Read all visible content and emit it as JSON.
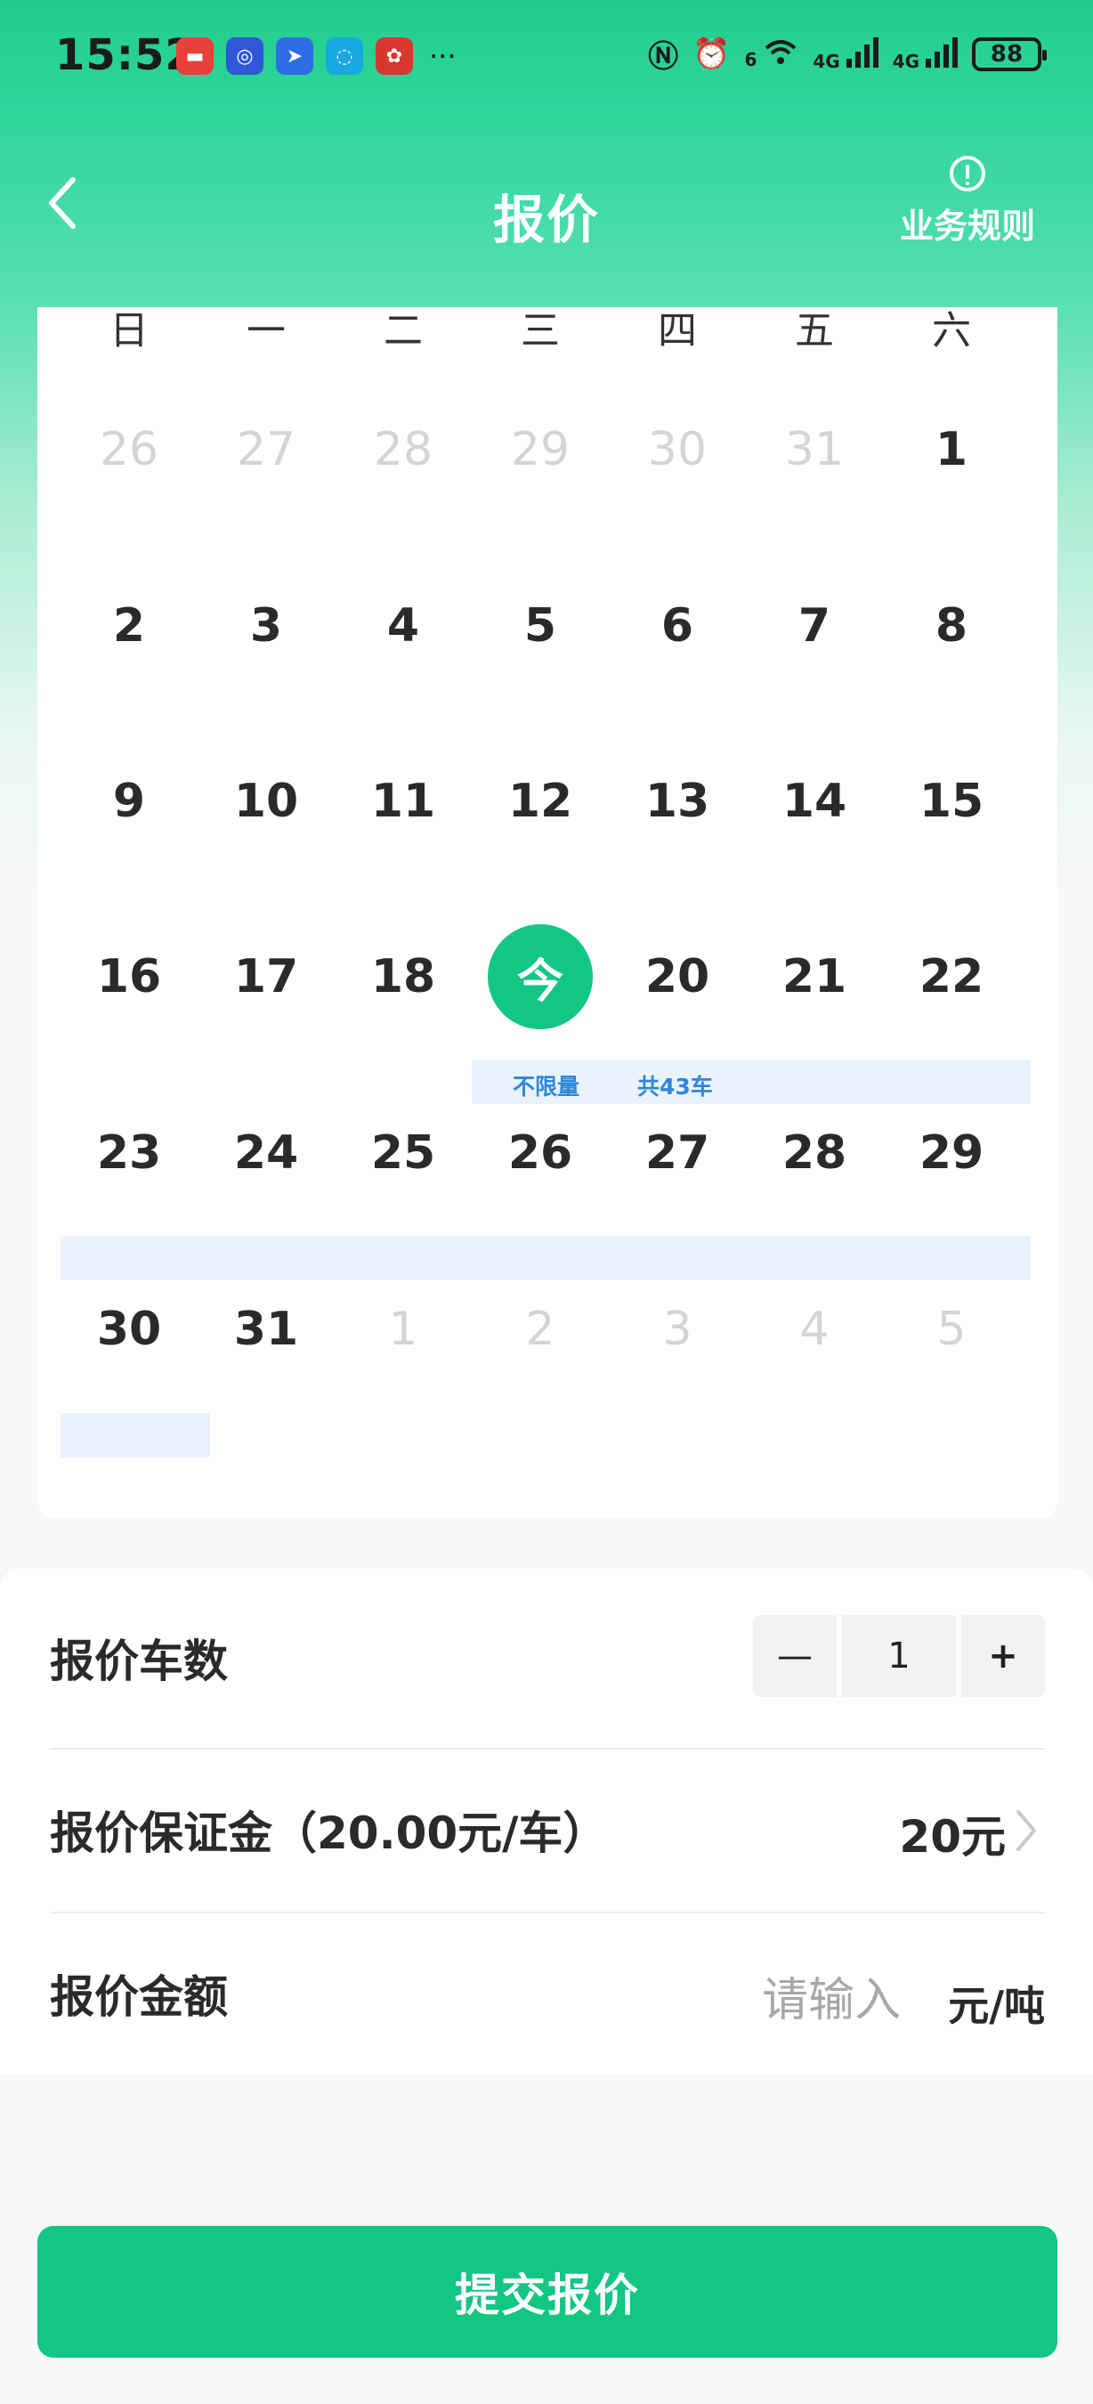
{
  "status_bar": {
    "time": "15:52",
    "app_icons": [
      {
        "name": "huawei-icon",
        "color": "#e8403a"
      },
      {
        "name": "ring-app-icon",
        "color": "#2f57d8"
      },
      {
        "name": "dingtalk-icon",
        "color": "#2d6ee6"
      },
      {
        "name": "chat-app-icon",
        "color": "#1ba8e0"
      },
      {
        "name": "flower-app-icon",
        "color": "#d8362f"
      }
    ],
    "network_1": "6",
    "network_2": "4G",
    "network_3": "4G",
    "battery": "88"
  },
  "header": {
    "title": "报价",
    "rules_label": "业务规则"
  },
  "calendar": {
    "weekdays": [
      "日",
      "一",
      "二",
      "三",
      "四",
      "五",
      "六"
    ],
    "rows": [
      [
        {
          "d": "26",
          "m": true
        },
        {
          "d": "27",
          "m": true
        },
        {
          "d": "28",
          "m": true
        },
        {
          "d": "29",
          "m": true
        },
        {
          "d": "30",
          "m": true
        },
        {
          "d": "31",
          "m": true
        },
        {
          "d": "1",
          "m": false
        }
      ],
      [
        {
          "d": "2",
          "m": false
        },
        {
          "d": "3",
          "m": false
        },
        {
          "d": "4",
          "m": false
        },
        {
          "d": "5",
          "m": false
        },
        {
          "d": "6",
          "m": false
        },
        {
          "d": "7",
          "m": false
        },
        {
          "d": "8",
          "m": false
        }
      ],
      [
        {
          "d": "9",
          "m": false
        },
        {
          "d": "10",
          "m": false
        },
        {
          "d": "11",
          "m": false
        },
        {
          "d": "12",
          "m": false
        },
        {
          "d": "13",
          "m": false
        },
        {
          "d": "14",
          "m": false
        },
        {
          "d": "15",
          "m": false
        }
      ],
      [
        {
          "d": "16",
          "m": false
        },
        {
          "d": "17",
          "m": false
        },
        {
          "d": "18",
          "m": false
        },
        {
          "d": "今",
          "m": false,
          "today": true
        },
        {
          "d": "20",
          "m": false
        },
        {
          "d": "21",
          "m": false
        },
        {
          "d": "22",
          "m": false
        }
      ],
      [
        {
          "d": "23",
          "m": false
        },
        {
          "d": "24",
          "m": false
        },
        {
          "d": "25",
          "m": false
        },
        {
          "d": "26",
          "m": false
        },
        {
          "d": "27",
          "m": false
        },
        {
          "d": "28",
          "m": false
        },
        {
          "d": "29",
          "m": false
        }
      ],
      [
        {
          "d": "30",
          "m": false
        },
        {
          "d": "31",
          "m": false
        },
        {
          "d": "1",
          "m": true
        },
        {
          "d": "2",
          "m": true
        },
        {
          "d": "3",
          "m": true
        },
        {
          "d": "4",
          "m": true
        },
        {
          "d": "5",
          "m": true
        }
      ]
    ],
    "range_limit": "不限量",
    "range_total": "共43车"
  },
  "form": {
    "quantity_label": "报价车数",
    "quantity_minus": "—",
    "quantity_value": "1",
    "quantity_plus": "+",
    "deposit_label": "报价保证金（20.00元/车）",
    "deposit_value": "20元",
    "amount_label": "报价金额",
    "amount_placeholder": "请输入",
    "amount_value": "",
    "amount_unit": "元/吨"
  },
  "submit_label": "提交报价",
  "colors": {
    "brand_green": "#13c685",
    "band_blue": "#eaf3fd",
    "band_text": "#2f87d8",
    "muted_day": "#d4d4d4"
  }
}
